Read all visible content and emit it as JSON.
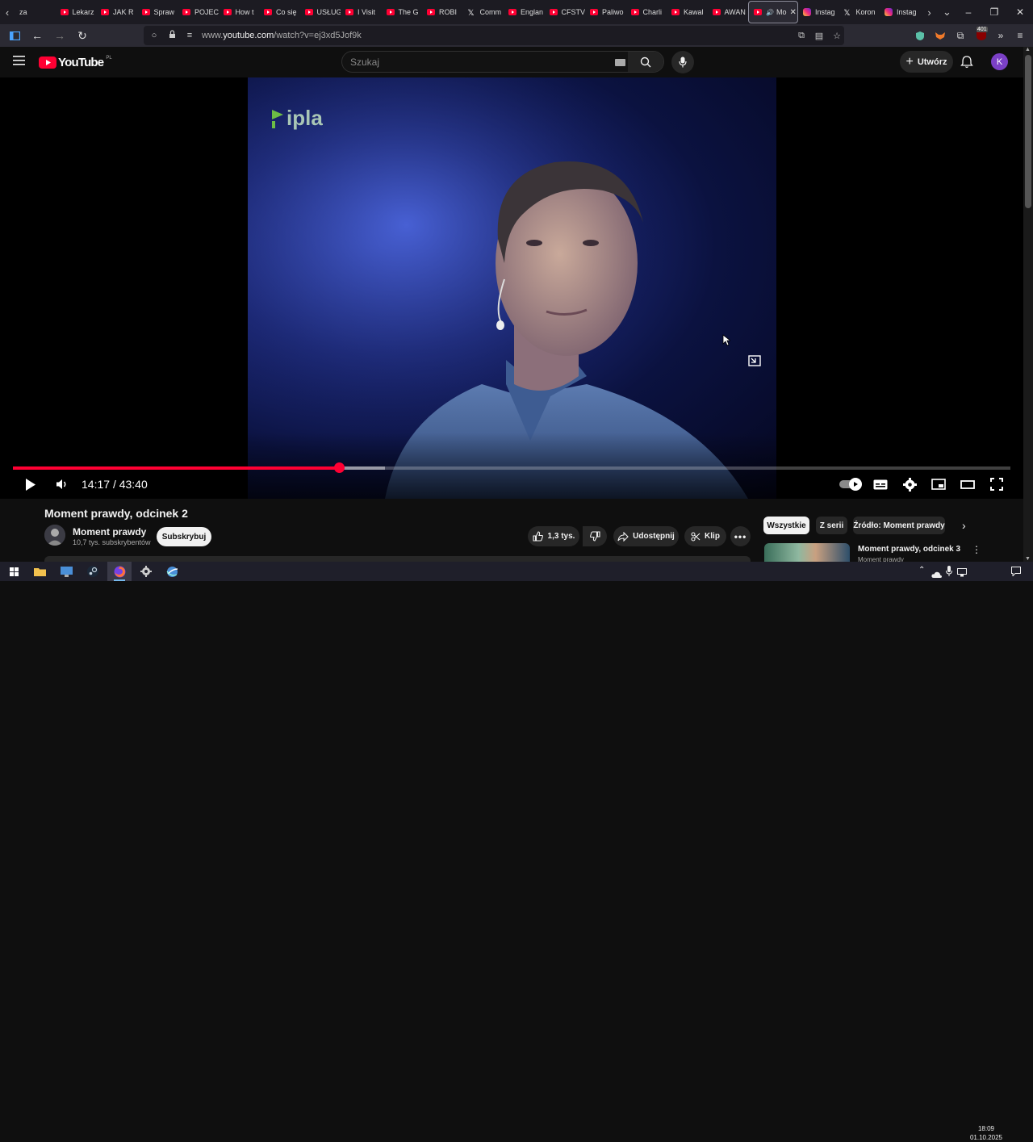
{
  "browser": {
    "tabs": [
      {
        "label": "za",
        "icon": "none"
      },
      {
        "label": "Lekarz",
        "icon": "youtube"
      },
      {
        "label": "JAK R",
        "icon": "youtube"
      },
      {
        "label": "Spraw",
        "icon": "youtube"
      },
      {
        "label": "POJEC",
        "icon": "youtube"
      },
      {
        "label": "How t",
        "icon": "youtube"
      },
      {
        "label": "Co się",
        "icon": "youtube"
      },
      {
        "label": "USŁUG",
        "icon": "youtube"
      },
      {
        "label": "I Visit",
        "icon": "youtube"
      },
      {
        "label": "The G",
        "icon": "youtube"
      },
      {
        "label": "ROBI",
        "icon": "youtube"
      },
      {
        "label": "Comm",
        "icon": "x"
      },
      {
        "label": "Englan",
        "icon": "youtube"
      },
      {
        "label": "CFSTV",
        "icon": "youtube"
      },
      {
        "label": "Paliwo",
        "icon": "youtube"
      },
      {
        "label": "Charli",
        "icon": "youtube"
      },
      {
        "label": "Kawal",
        "icon": "youtube"
      },
      {
        "label": "AWAN",
        "icon": "youtube"
      },
      {
        "label": "Mo",
        "icon": "youtube",
        "active": true
      },
      {
        "label": "Instag",
        "icon": "instagram"
      },
      {
        "label": "Koron",
        "icon": "x"
      },
      {
        "label": "Instag",
        "icon": "instagram"
      }
    ],
    "url_prefix": "www.",
    "url_domain": "youtube.com",
    "url_path": "/watch?v=ej3xd5Jof9k",
    "notification_count": "401"
  },
  "youtube": {
    "logo_text": "YouTube",
    "region": "PL",
    "search_placeholder": "Szukaj",
    "create_label": "Utwórz",
    "avatar_letter": "K"
  },
  "player": {
    "overlay_logo": "ipla",
    "current_time": "14:17",
    "duration": "43:40",
    "time_separator": "/",
    "progress_fraction": 0.327,
    "buffered_fraction": 0.373,
    "accent_color": "#ff0033"
  },
  "video": {
    "title": "Moment prawdy, odcinek 2",
    "channel_name": "Moment prawdy",
    "subscribers": "10,7 tys. subskrybentów",
    "subscribe_label": "Subskrybuj",
    "likes": "1,3 tys.",
    "share_label": "Udostępnij",
    "clip_label": "Klip"
  },
  "sidebar": {
    "chips": [
      "Wszystkie",
      "Z serii",
      "Źródło: Moment prawdy"
    ],
    "next_video_title": "Moment prawdy, odcinek 3",
    "next_video_channel": "Moment prawdy"
  },
  "taskbar": {
    "time": "18:09",
    "date": "01.10.2025"
  }
}
